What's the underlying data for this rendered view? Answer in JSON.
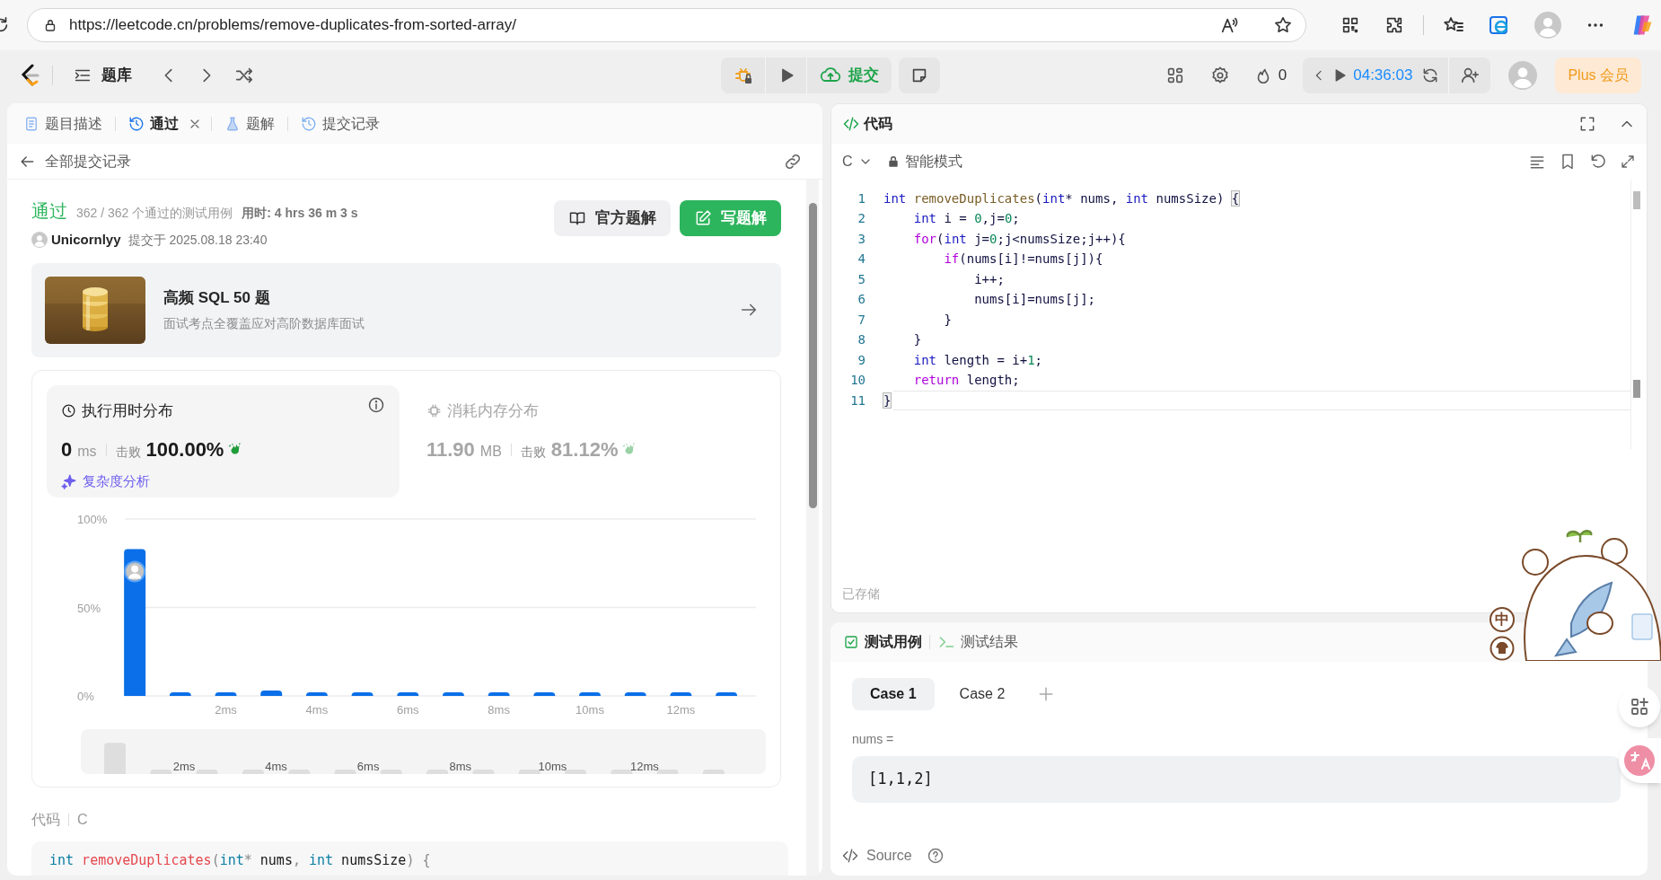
{
  "browser": {
    "url": "https://leetcode.cn/problems/remove-duplicates-from-sorted-array/"
  },
  "header": {
    "problem_list": "题库",
    "submit": "提交",
    "streak": "0",
    "timer": "04:36:03",
    "plus": "Plus 会员"
  },
  "left_tabs": [
    {
      "label": "题目描述",
      "kind": "doc",
      "selected": false,
      "closable": false
    },
    {
      "label": "通过",
      "kind": "history",
      "selected": true,
      "closable": true
    },
    {
      "label": "题解",
      "kind": "flask",
      "selected": false,
      "closable": false
    },
    {
      "label": "提交记录",
      "kind": "history",
      "selected": false,
      "closable": false
    }
  ],
  "back_label": "全部提交记录",
  "submission": {
    "status": "通过",
    "cases": "362 / 362 个通过的测试用例",
    "duration": "用时: 4 hrs 36 m 3 s",
    "user": "Unicornlyy",
    "submitted": "提交于 2025.08.18 23:40"
  },
  "action_buttons": [
    {
      "label": "官方题解",
      "kind": "book"
    },
    {
      "label": "写题解",
      "kind": "write"
    }
  ],
  "promo": {
    "title": "高频 SQL 50 题",
    "subtitle": "面试考点全覆盖应对高阶数据库面试"
  },
  "stats": [
    {
      "title": "执行用时分布",
      "kind": "clock",
      "value": "0",
      "unit": "ms",
      "beat_label": "击败",
      "beat": "100.00%",
      "selected": true
    },
    {
      "title": "消耗内存分布",
      "kind": "chip",
      "value": "11.90",
      "unit": "MB",
      "beat_label": "击败",
      "beat": "81.12%",
      "selected": false
    }
  ],
  "analysis": "复杂度分析",
  "chart_data": {
    "type": "bar",
    "x": [
      0,
      1,
      2,
      3,
      4,
      5,
      6,
      7,
      8,
      9,
      10,
      11,
      12,
      13
    ],
    "series": [
      {
        "color": "#0a6fe8",
        "values": [
          83,
          2,
          2,
          3,
          2,
          2,
          2,
          2,
          2,
          2,
          2,
          2,
          2,
          2
        ]
      }
    ],
    "xlim": [
      -0.22,
      13.65
    ],
    "ylim": [
      0,
      100
    ],
    "yticks": [
      {
        "value": 0,
        "label": "0%"
      },
      {
        "value": 50,
        "label": "50%"
      },
      {
        "value": 100,
        "label": "100%"
      }
    ],
    "xticks": [
      {
        "value": 2,
        "label": "2ms"
      },
      {
        "value": 4,
        "label": "4ms"
      },
      {
        "value": 6,
        "label": "6ms"
      },
      {
        "value": 8,
        "label": "8ms"
      },
      {
        "value": 10,
        "label": "10ms"
      },
      {
        "value": 12,
        "label": "12ms"
      }
    ]
  },
  "overview_labels": [
    "2ms",
    "4ms",
    "6ms",
    "8ms",
    "10ms",
    "12ms"
  ],
  "snippet": {
    "label": "代码",
    "language": "C",
    "lines": [
      {
        "tokens": [
          {
            "kind": "type",
            "text": "int"
          },
          {
            "kind": "fn",
            "text": " removeDuplicates"
          },
          {
            "kind": "punct",
            "text": "("
          },
          {
            "kind": "type",
            "text": "int"
          },
          {
            "kind": "punct",
            "text": "*"
          },
          {
            "kind": "plain",
            "text": " nums"
          },
          {
            "kind": "punct",
            "text": ","
          },
          {
            "kind": "type",
            "text": " int"
          },
          {
            "kind": "plain",
            "text": " numsSize"
          },
          {
            "kind": "punct",
            "text": ")"
          },
          {
            "kind": "punct",
            "text": " {"
          }
        ]
      }
    ]
  },
  "editor": {
    "title": "代码",
    "language": "C",
    "mode": "智能模式",
    "saved": "已存储",
    "lines": [
      {
        "n": "1",
        "tokens": [
          {
            "kind": "type",
            "text": "int"
          },
          {
            "kind": "fn",
            "text": " removeDuplicates"
          },
          {
            "kind": "plain",
            "text": "("
          },
          {
            "kind": "type",
            "text": "int"
          },
          {
            "kind": "plain",
            "text": "* nums, "
          },
          {
            "kind": "type",
            "text": "int"
          },
          {
            "kind": "plain",
            "text": " numsSize) "
          },
          {
            "kind": "bracket",
            "text": "{"
          }
        ]
      },
      {
        "n": "2",
        "tokens": [
          {
            "kind": "type",
            "text": "    int"
          },
          {
            "kind": "plain",
            "text": " i = "
          },
          {
            "kind": "num",
            "text": "0"
          },
          {
            "kind": "plain",
            "text": ",j="
          },
          {
            "kind": "num",
            "text": "0"
          },
          {
            "kind": "plain",
            "text": ";"
          }
        ]
      },
      {
        "n": "3",
        "tokens": [
          {
            "kind": "ctrl",
            "text": "    for"
          },
          {
            "kind": "plain",
            "text": "("
          },
          {
            "kind": "type",
            "text": "int"
          },
          {
            "kind": "plain",
            "text": " j="
          },
          {
            "kind": "num",
            "text": "0"
          },
          {
            "kind": "plain",
            "text": ";j<numsSize;j++){"
          }
        ]
      },
      {
        "n": "4",
        "tokens": [
          {
            "kind": "ctrl",
            "text": "        if"
          },
          {
            "kind": "plain",
            "text": "(nums[i]!=nums[j]){"
          }
        ]
      },
      {
        "n": "5",
        "tokens": [
          {
            "kind": "plain",
            "text": "            i++;"
          }
        ]
      },
      {
        "n": "6",
        "tokens": [
          {
            "kind": "plain",
            "text": "            nums[i]=nums[j];"
          }
        ]
      },
      {
        "n": "7",
        "tokens": [
          {
            "kind": "plain",
            "text": "        }"
          }
        ]
      },
      {
        "n": "8",
        "tokens": [
          {
            "kind": "plain",
            "text": "    }"
          }
        ]
      },
      {
        "n": "9",
        "tokens": [
          {
            "kind": "type",
            "text": "    int"
          },
          {
            "kind": "plain",
            "text": " length = i+"
          },
          {
            "kind": "num",
            "text": "1"
          },
          {
            "kind": "plain",
            "text": ";"
          }
        ]
      },
      {
        "n": "10",
        "tokens": [
          {
            "kind": "ctrl",
            "text": "    return"
          },
          {
            "kind": "plain",
            "text": " length;"
          }
        ]
      },
      {
        "n": "11",
        "tokens": [
          {
            "kind": "bracket",
            "text": "}"
          }
        ]
      }
    ]
  },
  "test_panel": {
    "tabs": [
      {
        "label": "测试用例",
        "kind": "check",
        "selected": true
      },
      {
        "label": "测试结果",
        "kind": "terminal",
        "selected": false
      }
    ],
    "cases": [
      {
        "label": "Case 1",
        "selected": true
      },
      {
        "label": "Case 2",
        "selected": false
      }
    ],
    "param_label": "nums =",
    "param_value": "[1,1,2]",
    "source": "Source"
  },
  "widget": {
    "label": "中"
  }
}
